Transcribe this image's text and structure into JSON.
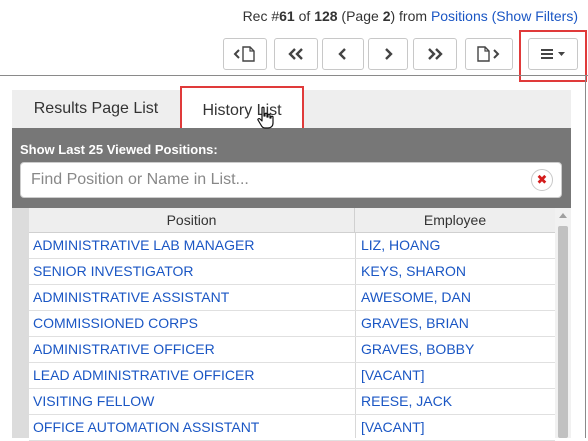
{
  "record_nav": {
    "prefix": "Rec #",
    "current": "61",
    "of_text": " of ",
    "total": "128",
    "page_prefix": " (Page ",
    "page": "2",
    "page_suffix": ") from ",
    "source_link": "Positions",
    "filters_link": "(Show Filters)"
  },
  "toolbar": {
    "buttons": [
      {
        "name": "first-record-button",
        "icon": "previous-document-icon"
      },
      {
        "name": "first-page-button",
        "icon": "double-chevron-left-icon"
      },
      {
        "name": "previous-button",
        "icon": "chevron-left-icon"
      },
      {
        "name": "next-button",
        "icon": "chevron-right-icon"
      },
      {
        "name": "last-page-button",
        "icon": "double-chevron-right-icon"
      },
      {
        "name": "next-document-button",
        "icon": "next-document-icon"
      },
      {
        "name": "menu-button",
        "icon": "hamburger-caret-icon"
      }
    ]
  },
  "tabs": [
    {
      "label": "Results Page List",
      "active": false
    },
    {
      "label": "History List",
      "active": true
    }
  ],
  "history": {
    "label": "Show Last 25 Viewed Positions:",
    "search_placeholder": "Find Position or Name in List...",
    "search_value": ""
  },
  "table": {
    "columns": [
      "Position",
      "Employee"
    ],
    "rows": [
      {
        "position": "ADMINISTRATIVE LAB MANAGER",
        "employee": "LIZ, HOANG"
      },
      {
        "position": "SENIOR INVESTIGATOR",
        "employee": "KEYS, SHARON"
      },
      {
        "position": "ADMINISTRATIVE ASSISTANT",
        "employee": "AWESOME, DAN"
      },
      {
        "position": "COMMISSIONED CORPS",
        "employee": "GRAVES, BRIAN"
      },
      {
        "position": "ADMINISTRATIVE OFFICER",
        "employee": "GRAVES, BOBBY"
      },
      {
        "position": "LEAD ADMINISTRATIVE OFFICER",
        "employee": "[VACANT]"
      },
      {
        "position": "VISITING FELLOW",
        "employee": "REESE, JACK"
      },
      {
        "position": "OFFICE AUTOMATION ASSISTANT",
        "employee": "[VACANT]"
      }
    ]
  },
  "colors": {
    "link": "#1a56c4",
    "highlight": "#e03a3a",
    "panel_grey": "#777777",
    "clear_red": "#d41c1c"
  }
}
